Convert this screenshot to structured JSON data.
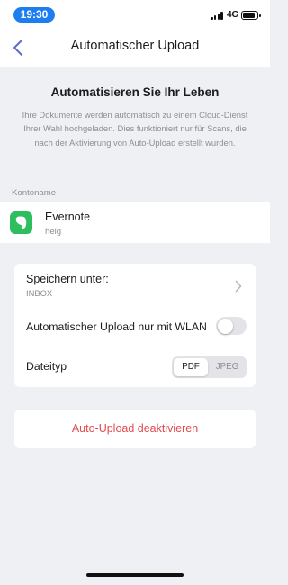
{
  "status_bar": {
    "time": "19:30",
    "network": "4G",
    "accent": "#1e7ef0"
  },
  "nav": {
    "title": "Automatischer Upload",
    "back_icon": "chevron-left-icon",
    "accent": "#5b6ed4"
  },
  "intro": {
    "heading": "Automatisieren Sie Ihr Leben",
    "text": "Ihre Dokumente werden automatisch zu einem Cloud-Dienst Ihrer Wahl hochgeladen. Dies funktioniert nur für Scans, die nach der Aktivierung von Auto-Upload erstellt wurden."
  },
  "account": {
    "section_label": "Kontoname",
    "name": "Evernote",
    "user": "heig",
    "icon": "evernote-icon",
    "icon_color": "#2dbe60"
  },
  "settings": {
    "save_label": "Speichern unter:",
    "save_value": "INBOX",
    "wlan_label": "Automatischer Upload nur mit WLAN",
    "wlan_enabled": false,
    "type_label": "Dateityp",
    "type_options": [
      "PDF",
      "JPEG"
    ],
    "type_selected": "PDF"
  },
  "deactivate": {
    "label": "Auto-Upload deaktivieren",
    "color": "#e34a4e"
  }
}
